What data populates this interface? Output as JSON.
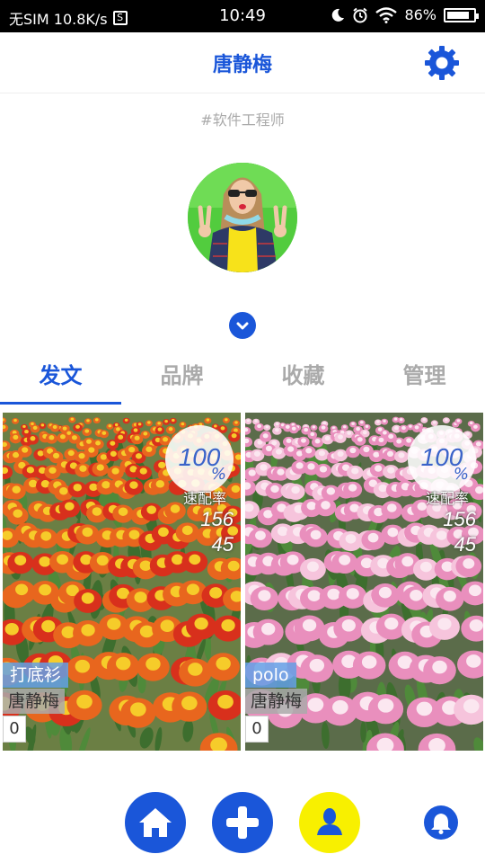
{
  "status_bar": {
    "carrier": "无SIM 10.8K/s",
    "sim_icon_text": "S",
    "time": "10:49",
    "battery": "86%",
    "battery_level": 0.86,
    "icons": [
      "moon-icon",
      "alarm-icon",
      "wifi-icon",
      "battery-icon"
    ]
  },
  "header": {
    "title": "唐静梅",
    "settings_icon": "gear-icon",
    "accent": "#1a56d9"
  },
  "profile": {
    "tagline": "#软件工程师",
    "expand_icon": "chevron-down-icon"
  },
  "tabs": [
    {
      "label": "发文",
      "active": true
    },
    {
      "label": "品牌",
      "active": false
    },
    {
      "label": "收藏",
      "active": false
    },
    {
      "label": "管理",
      "active": false
    }
  ],
  "cards": [
    {
      "rate": "100",
      "rate_unit": "%",
      "rate_label": "速配率",
      "stat_a": "156",
      "stat_b": "45",
      "category": "打底衫",
      "author": "唐静梅",
      "count": "0",
      "photo": "red-orange tulip field"
    },
    {
      "rate": "100",
      "rate_unit": "%",
      "rate_label": "速配率",
      "stat_a": "156",
      "stat_b": "45",
      "category": "polo",
      "author": "唐静梅",
      "count": "0",
      "photo": "pink tulip field"
    }
  ],
  "bottom_nav": {
    "items": [
      "home-icon",
      "add-icon",
      "user-icon",
      "bell-icon"
    ],
    "colors": {
      "primary": "#1a56d9",
      "active_user": "#f8f000"
    }
  }
}
